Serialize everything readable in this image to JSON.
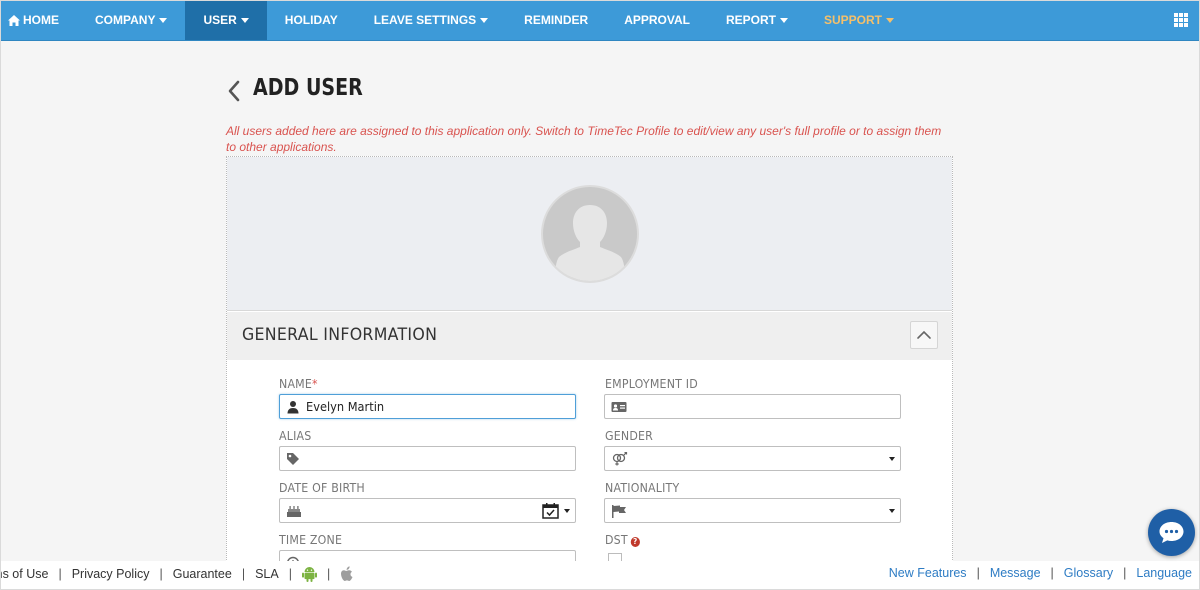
{
  "nav": {
    "home": "HOME",
    "company": "COMPANY",
    "user": "USER",
    "holiday": "HOLIDAY",
    "leave_settings": "LEAVE SETTINGS",
    "reminder": "REMINDER",
    "approval": "APPROVAL",
    "report": "REPORT",
    "support": "SUPPORT"
  },
  "colors": {
    "nav_bg": "#3d9ad8",
    "nav_active": "#1f6fa8",
    "support_text": "#f5c06a",
    "notice_text": "#d9534f",
    "link": "#2e7cc4"
  },
  "page": {
    "title": "ADD USER",
    "notice": "All users added here are assigned to this application only. Switch to TimeTec Profile to edit/view any user's full profile or to assign them to other applications."
  },
  "section": {
    "title": "GENERAL INFORMATION"
  },
  "form": {
    "name_label": "NAME",
    "name_required": "*",
    "name_value": "Evelyn Martin",
    "employment_id_label": "EMPLOYMENT ID",
    "employment_id_value": "",
    "alias_label": "ALIAS",
    "alias_value": "",
    "gender_label": "GENDER",
    "gender_value": "",
    "dob_label": "DATE OF BIRTH",
    "dob_value": "",
    "nationality_label": "NATIONALITY",
    "nationality_value": "",
    "timezone_label": "TIME ZONE",
    "dst_label": "DST",
    "dst_help": "?"
  },
  "footer": {
    "terms": "rms of Use",
    "privacy": "Privacy Policy",
    "guarantee": "Guarantee",
    "sla": "SLA",
    "sep": "|",
    "new_features": "New Features",
    "message": "Message",
    "glossary": "Glossary",
    "language": "Language"
  },
  "icons": {
    "home": "home-icon",
    "apps": "apps-grid-icon",
    "back": "chevron-left-icon",
    "avatar": "user-silhouette-icon",
    "collapse": "chevron-up-icon",
    "name": "user-icon",
    "employment_id": "id-card-icon",
    "alias": "tag-icon",
    "gender": "gender-icon",
    "dob": "birthday-cake-icon",
    "calendar": "calendar-check-icon",
    "nationality": "flag-icon",
    "timezone": "clock-icon",
    "android": "android-icon",
    "apple": "apple-icon",
    "chat": "chat-bubble-icon"
  }
}
